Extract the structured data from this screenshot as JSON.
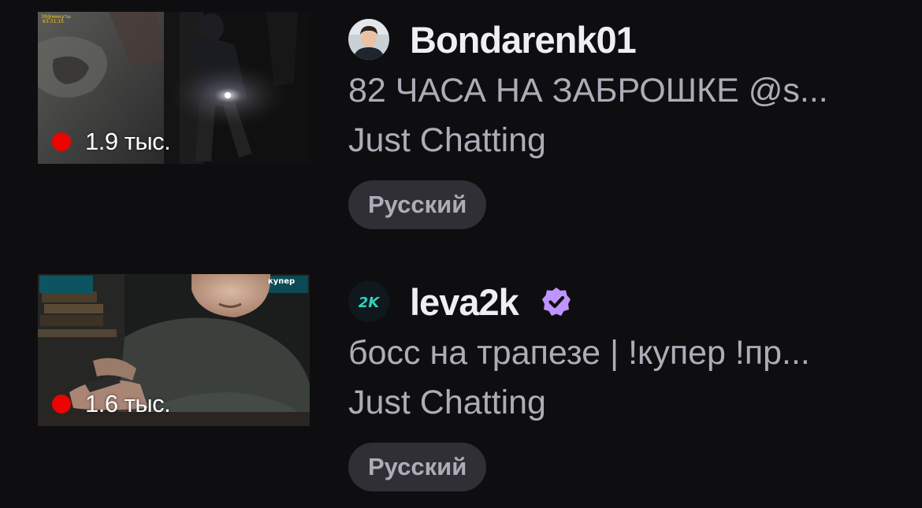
{
  "colors": {
    "background": "#0e0e10",
    "live": "#eb0400",
    "verified": "#bf94ff",
    "tag_bg": "#2f2f35",
    "text_primary": "#efeff1",
    "text_secondary": "#adadb8"
  },
  "streams": [
    {
      "channel": "Bondarenk01",
      "viewers": "1.9 тыс.",
      "title": "82 ЧАСА НА ЗАБРОШКЕ @s...",
      "category": "Just Chatting",
      "tag": "Русский",
      "verified": false,
      "avatar": "avatar-bondarenk01",
      "thumbnail": "stream-thumbnail-abandoned-building"
    },
    {
      "channel": "leva2k",
      "viewers": "1.6 тыс.",
      "title": "босс на трапезе | !купер !пр...",
      "category": "Just Chatting",
      "tag": "Русский",
      "verified": true,
      "avatar": "avatar-leva2k-logo",
      "avatar_text": "2K",
      "verified_icon": "verified-badge-icon",
      "thumbnail": "stream-thumbnail-streamer-room",
      "thumbnail_overlay": "купер"
    }
  ]
}
